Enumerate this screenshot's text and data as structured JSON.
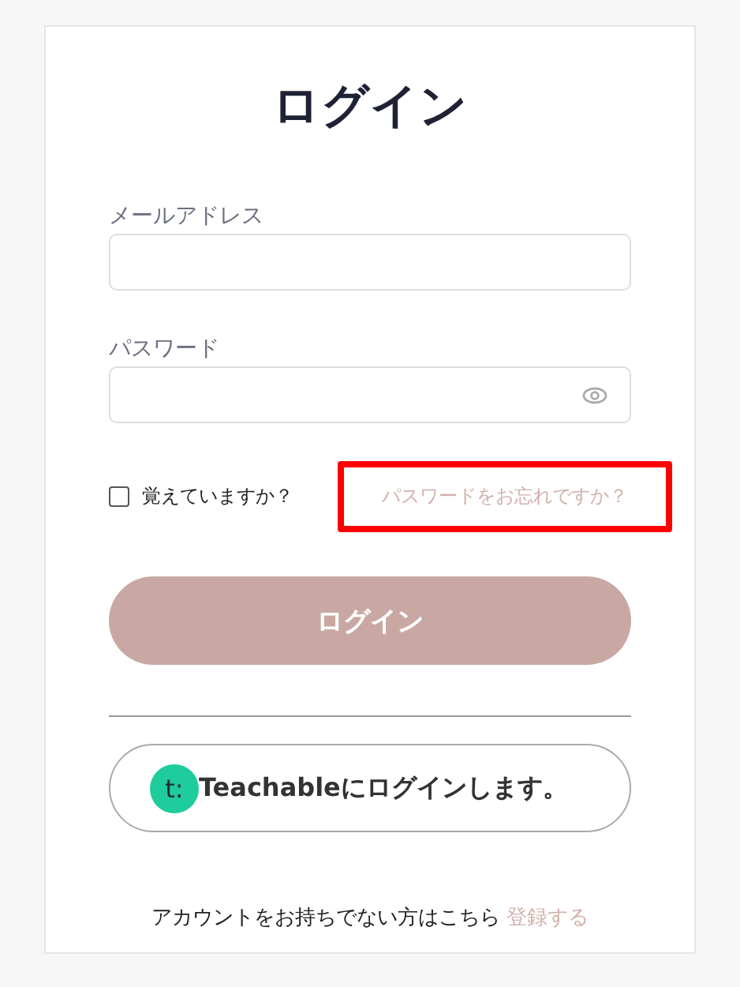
{
  "title": "ログイン",
  "email": {
    "label": "メールアドレス"
  },
  "password": {
    "label": "パスワード",
    "show_toggle": true
  },
  "remember": {
    "label": "覚えていますか？",
    "checked": false
  },
  "forgot": {
    "label": "パスワードをお忘れですか？",
    "highlighted": true
  },
  "login_button": {
    "label": "ログイン"
  },
  "teachable_button": {
    "logo": "t:",
    "label": "Teachableにログインします。"
  },
  "signup": {
    "text": "アカウントをお持ちでない方はこちら",
    "link": "登録する"
  }
}
